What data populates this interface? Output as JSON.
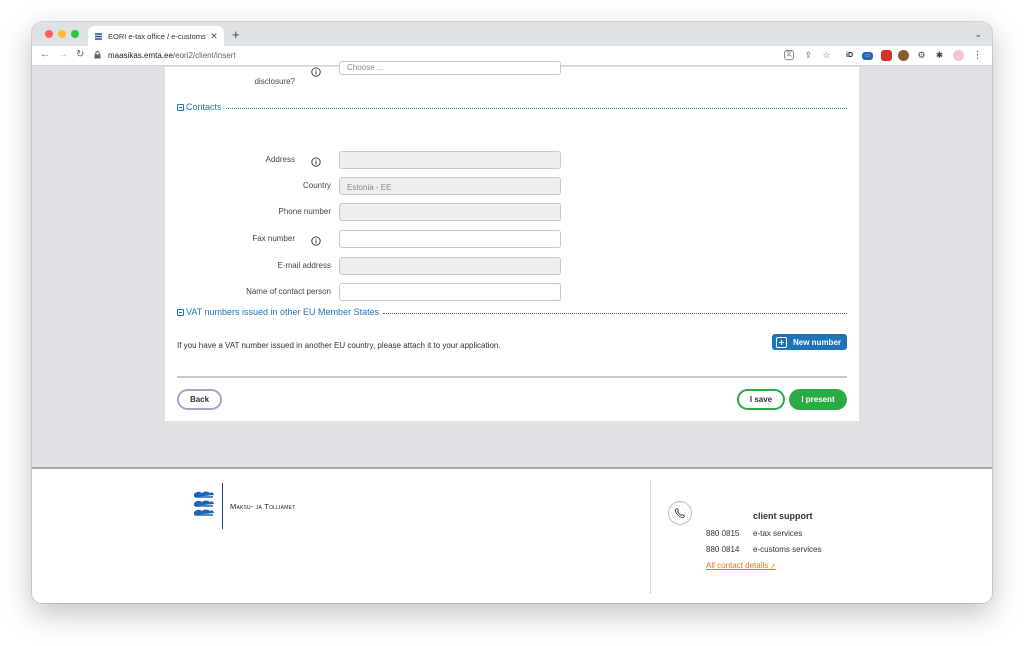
{
  "browser": {
    "tab_title": "EORI e-tax office / e-customs",
    "tab_close": "✕",
    "new_tab": "+",
    "url_host": "maasikas.emta.ee",
    "url_path": "/eori2/client/insert"
  },
  "form": {
    "partial_field": {
      "label": "disclosure?",
      "value": "Choose ..."
    },
    "contacts": {
      "title": "Contacts",
      "fields": [
        {
          "label": "Address",
          "value": "",
          "disabled": true,
          "info": true
        },
        {
          "label": "Country",
          "value": "Estonia - EE",
          "disabled": true,
          "info": false
        },
        {
          "label": "Phone number",
          "value": "",
          "disabled": true,
          "info": false
        },
        {
          "label": "Fax number",
          "value": "",
          "disabled": false,
          "info": true
        },
        {
          "label": "E-mail address",
          "value": "",
          "disabled": true,
          "info": false
        },
        {
          "label": "Name of contact person",
          "value": "",
          "disabled": false,
          "info": false
        }
      ]
    },
    "vat": {
      "title": "VAT numbers issued in other EU Member States",
      "note": "If you have a VAT number issued in another EU country, please attach it to your application.",
      "new_button": "New number"
    },
    "actions": {
      "back": "Back",
      "save": "I save",
      "present": "I present"
    }
  },
  "footer": {
    "org_name": "Maksu- ja Tolliamet",
    "support_title": "client support",
    "lines": [
      {
        "number": "880 0815",
        "desc": "e-tax services"
      },
      {
        "number": "880 0814",
        "desc": "e-customs services"
      }
    ],
    "contact_link": "All contact details"
  },
  "colors": {
    "accent": "#1f73b7",
    "success": "#2cab45",
    "link": "#e8750c"
  }
}
